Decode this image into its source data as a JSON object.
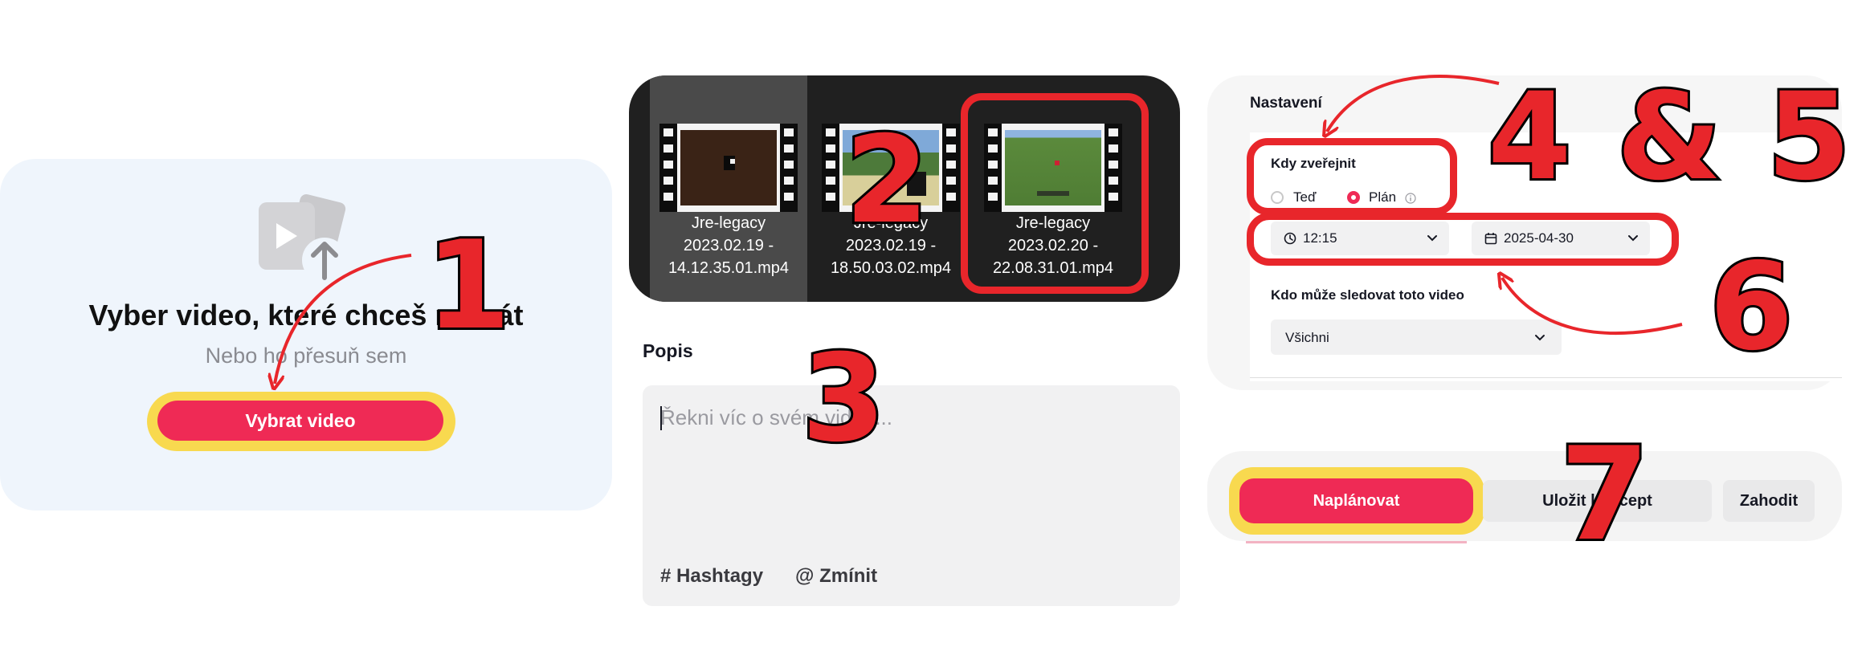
{
  "upload": {
    "title": "Vyber video, které chceš nahrát",
    "subtitle": "Nebo ho přesuň sem",
    "button_label": "Vybrat video",
    "icon": "video-upload-icon"
  },
  "file_picker": {
    "files": [
      {
        "line1": "Jre-legacy",
        "line2": "2023.02.19 -",
        "line3": "14.12.35.01.mp4",
        "selected": true
      },
      {
        "line1": "Jre-legacy",
        "line2": "2023.02.19 -",
        "line3": "18.50.03.02.mp4",
        "selected": false
      },
      {
        "line1": "Jre-legacy",
        "line2": "2023.02.20 -",
        "line3": "22.08.31.01.mp4",
        "selected": false
      }
    ]
  },
  "description": {
    "label": "Popis",
    "placeholder": "Řekni víc o svém videu...",
    "hashtags_label": "# Hashtagy",
    "mention_label": "@ Zmínit"
  },
  "settings": {
    "title": "Nastavení",
    "when_label": "Kdy zveřejnit",
    "option_now": "Teď",
    "option_plan": "Plán",
    "selected_option": "Plán",
    "time_value": "12:15",
    "date_value": "2025-04-30",
    "who_label": "Kdo může sledovat toto video",
    "who_value": "Všichni"
  },
  "actions": {
    "schedule_label": "Naplánovat",
    "save_draft_label": "Uložit koncept",
    "discard_label": "Zahodit"
  },
  "steps": {
    "s1": "1",
    "s2": "2",
    "s3": "3",
    "s45": "4 & 5",
    "s6": "6",
    "s7": "7"
  },
  "colors": {
    "accent": "#ef2a55",
    "highlight_yellow": "#f8d94f",
    "annotation_red": "#e8262b",
    "upload_card_bg": "#eff5fc"
  }
}
